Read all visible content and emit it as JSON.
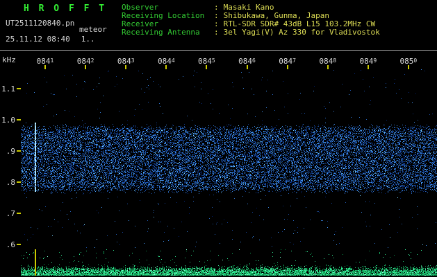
{
  "colors": {
    "background": "#000000",
    "title_green": "#33ee33",
    "label_green": "#33cc33",
    "value_yellow": "#dddd55",
    "axis_text": "#dddddd",
    "white_text": "#d8d8d8",
    "tick_yellow": "#cccc00",
    "separator_gray": "#aaaaaa",
    "noise_blue": "#2244cc",
    "echo_cyan": "#99ddff",
    "strip_green": "#22cc66",
    "marker_yellow": "#cccc00"
  },
  "window": {
    "title": "H R O F F T",
    "filename": "UT2511120840.pn",
    "file_note": "meteor",
    "timestamp": "25.11.12 08:40",
    "counter": "1.."
  },
  "field_separator": ":",
  "header_fields": [
    {
      "label": "Observer",
      "value": "Masaki Kano"
    },
    {
      "label": "Receiving Location",
      "value": "Shibukawa, Gunma, Japan"
    },
    {
      "label": "Receiver",
      "value": "RTL-SDR SDR# 43dB L15 103.2MHz CW"
    },
    {
      "label": "Receiving Antenna",
      "value": "3el Yagi(V) Az 330 for Vladivostok"
    }
  ],
  "chart_data": {
    "type": "heatmap",
    "x_axis": {
      "tick_labels": [
        "0841",
        "0842",
        "0843",
        "0844",
        "0845",
        "0846",
        "0847",
        "0848",
        "0849",
        "0850"
      ]
    },
    "y_axis": {
      "label": "kHz",
      "tick_labels": [
        "1.1",
        "1.0",
        ".9",
        ".8",
        ".7",
        ".6"
      ],
      "tick_values_khz": [
        1.1,
        1.0,
        0.9,
        0.8,
        0.7,
        0.6
      ],
      "range_khz": [
        0.58,
        1.16
      ]
    },
    "noise_band_khz": [
      0.76,
      0.99
    ],
    "echoes": [
      {
        "time_min_after_start": 0.74,
        "khz_span": [
          0.77,
          0.99
        ]
      }
    ],
    "bottom_strip": {
      "marker_time_min_after_start": 0.74
    },
    "grid": "off",
    "legend": "off"
  }
}
